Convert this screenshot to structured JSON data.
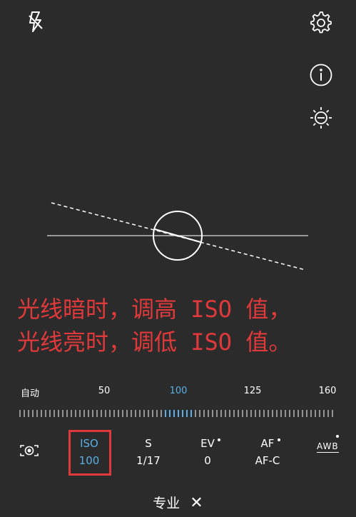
{
  "top_icons": {
    "flash": "flash-off-icon",
    "settings": "gear-icon",
    "info": "info-icon",
    "exposure": "brightness-icon"
  },
  "annotation": {
    "line1": "光线暗时，调高 ISO 值，",
    "line2": "光线亮时，调低 ISO 值。",
    "color": "#e0393b"
  },
  "iso_scale": {
    "labels": [
      "自动",
      "50",
      "100",
      "125",
      "160"
    ],
    "selected": "100",
    "accent": "#5ab0e6"
  },
  "params": [
    {
      "name": "ISO",
      "value": "100",
      "active": true
    },
    {
      "name": "S",
      "value": "1/17"
    },
    {
      "name": "EV",
      "value": "0"
    },
    {
      "name": "AF",
      "value": "AF-C"
    }
  ],
  "awb_label": "AWB",
  "metering_icon": "metering-icon",
  "mode_bar": {
    "label": "专业",
    "close": "✕"
  }
}
